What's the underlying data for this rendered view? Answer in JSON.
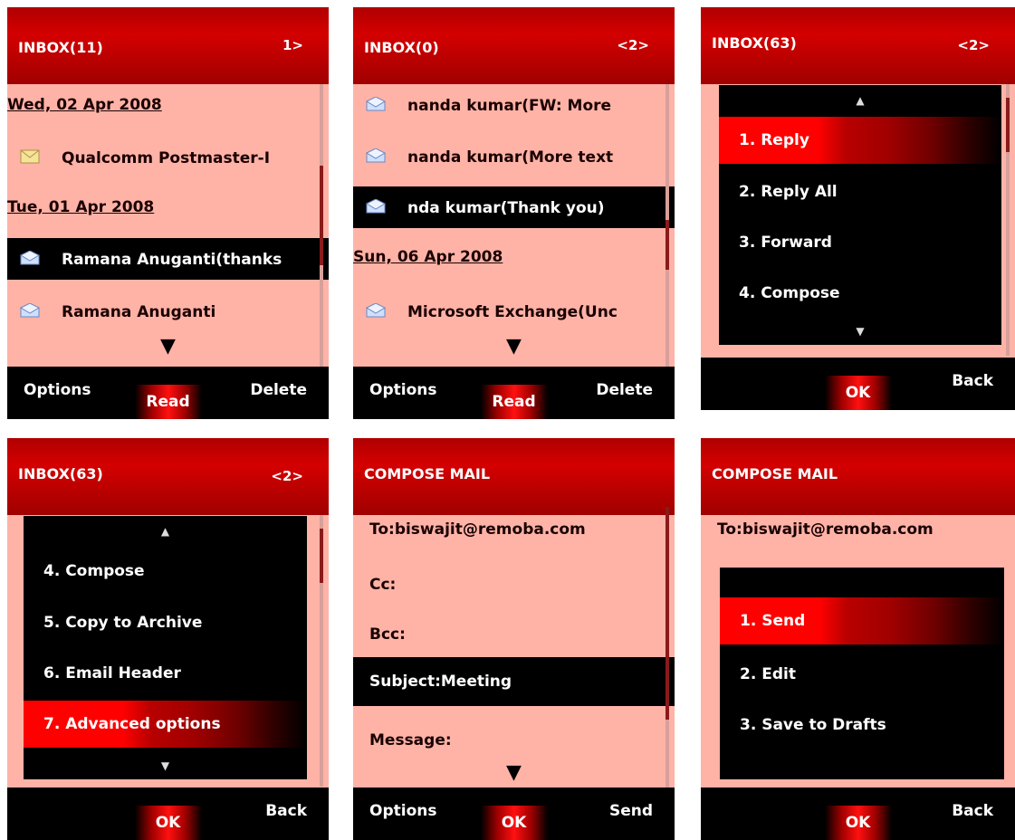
{
  "screens": [
    {
      "title": "INBOX(11)",
      "page": "1>",
      "dates": [
        "Wed, 02 Apr 2008",
        "Tue, 01 Apr 2008"
      ],
      "items": [
        "Qualcomm Postmaster-I",
        "Ramana Anuganti(thanks",
        "Ramana Anuganti"
      ],
      "soft": {
        "left": "Options",
        "center": "Read",
        "right": "Delete"
      }
    },
    {
      "title": "INBOX(0)",
      "page": "<2>",
      "items": [
        "nanda kumar(FW: More",
        "nanda kumar(More text",
        "nda kumar(Thank you)",
        "Microsoft Exchange(Unc"
      ],
      "dates": [
        "Sun, 06 Apr 2008"
      ],
      "soft": {
        "left": "Options",
        "center": "Read",
        "right": "Delete"
      }
    },
    {
      "title": "INBOX(63)",
      "page": "<2>",
      "menu": [
        "1. Reply",
        "2. Reply All",
        "3. Forward",
        "4. Compose"
      ],
      "soft": {
        "center": "OK",
        "right": "Back"
      }
    },
    {
      "title": "INBOX(63)",
      "page": "<2>",
      "menu": [
        "4. Compose",
        "5. Copy to Archive",
        "6. Email Header",
        "7. Advanced options"
      ],
      "soft": {
        "center": "OK",
        "right": "Back"
      }
    },
    {
      "title": "COMPOSE MAIL",
      "fields": [
        "To:biswajit@remoba.com",
        "Cc:",
        "Bcc:",
        "Subject:Meeting",
        "Message:"
      ],
      "soft": {
        "left": "Options",
        "center": "OK",
        "right": "Send"
      }
    },
    {
      "title": "COMPOSE MAIL",
      "to": "To:biswajit@remoba.com",
      "menu": [
        "1. Send",
        "2. Edit",
        "3. Save to Drafts"
      ],
      "soft": {
        "center": "OK",
        "right": "Back"
      }
    }
  ],
  "colors": {
    "header": "#c00000",
    "body": "#ffb3a7",
    "highlight": "#ff0000",
    "bar": "#000000"
  }
}
